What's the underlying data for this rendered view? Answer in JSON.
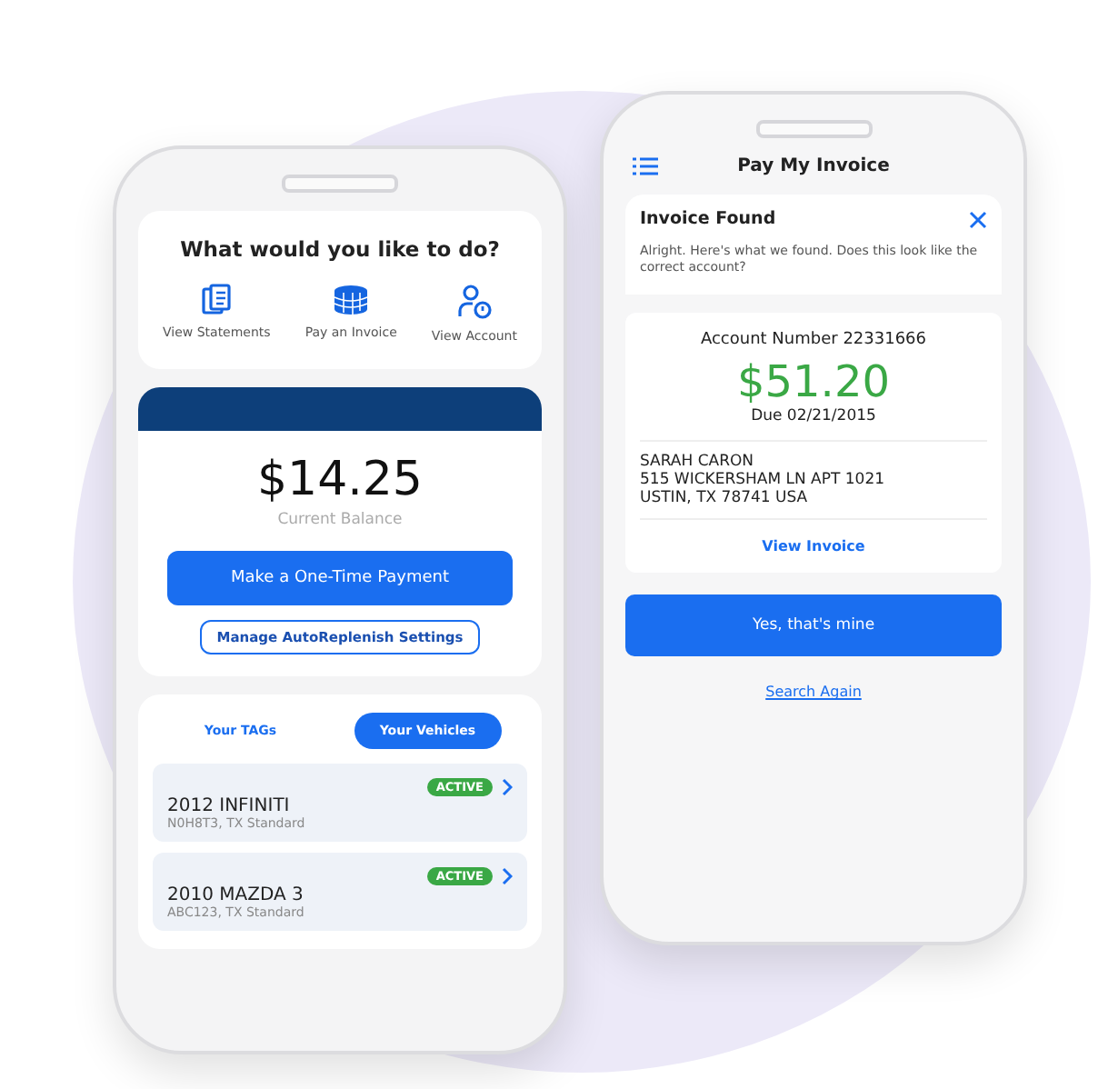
{
  "home_screen": {
    "prompt": "What would you like to do?",
    "actions": [
      {
        "label": "View Statements"
      },
      {
        "label": "Pay an Invoice"
      },
      {
        "label": "View Account"
      }
    ],
    "balance": {
      "amount": "$14.25",
      "caption": "Current Balance"
    },
    "primary_button": "Make a One-Time Payment",
    "secondary_button": "Manage AutoReplenish Settings",
    "tabs": [
      {
        "label": "Your TAGs",
        "selected": false
      },
      {
        "label": "Your Vehicles",
        "selected": true
      }
    ],
    "vehicles": [
      {
        "name": "2012 INFINITI",
        "details": "N0H8T3, TX Standard",
        "status": "ACTIVE"
      },
      {
        "name": "2010 MAZDA 3",
        "details": "ABC123, TX Standard",
        "status": "ACTIVE"
      }
    ]
  },
  "invoice_screen": {
    "title": "Pay My Invoice",
    "heading": "Invoice Found",
    "message": "Alright. Here's what we found. Does this look like the correct account?",
    "account_number": "Account Number 22331666",
    "amount": "$51.20",
    "due": "Due 02/21/2015",
    "address_lines": [
      "SARAH CARON",
      "515 WICKERSHAM LN APT 1021",
      "USTIN, TX 78741 USA"
    ],
    "view_link": "View Invoice",
    "confirm_button": "Yes, that's mine",
    "search_link": "Search Again"
  }
}
